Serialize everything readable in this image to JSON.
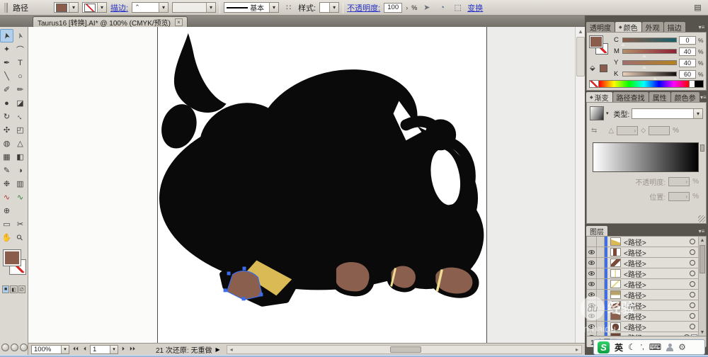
{
  "app": {
    "accent_blue": "#2936c6",
    "selection_blue": "#3b6cf0"
  },
  "control_bar": {
    "selection_type_label": "路径",
    "fill_color": "#8a5c4b",
    "stroke_link": "描边:",
    "brush_name": "基本",
    "style_label": "样式:",
    "opacity_link": "不透明度:",
    "opacity_value": "100",
    "stepper_glyph": "›",
    "percent": "%",
    "transform_link": "变换",
    "caret_glyph": "▾",
    "recolor_glyph": "∷",
    "select_similar_glyph": "➤",
    "sphere_glyph": "◔",
    "pattern_glyph": "⬚",
    "workspace_glyph": "▤"
  },
  "document_tab": {
    "title": "Taurus16 [转换].AI* @ 100% (CMYK/预览)",
    "close": "×"
  },
  "toolbox": {
    "tools": [
      {
        "name": "selection-tool",
        "glyph": "➤",
        "rotate": -105,
        "active": true
      },
      {
        "name": "direct-selection-tool",
        "glyph": "➢",
        "rotate": -105
      },
      {
        "name": "magic-wand-tool",
        "glyph": "✦"
      },
      {
        "name": "lasso-tool",
        "glyph": "⌒"
      },
      {
        "name": "pen-tool",
        "glyph": "✒"
      },
      {
        "name": "type-tool",
        "glyph": "T"
      },
      {
        "name": "line-segment-tool",
        "glyph": "╲"
      },
      {
        "name": "shape-tool",
        "glyph": "○"
      },
      {
        "name": "paintbrush-tool",
        "glyph": "✐"
      },
      {
        "name": "pencil-tool",
        "glyph": "✏"
      },
      {
        "name": "blob-brush-tool",
        "glyph": "●"
      },
      {
        "name": "eraser-tool",
        "glyph": "◪"
      },
      {
        "name": "rotate-tool",
        "glyph": "↻"
      },
      {
        "name": "scale-tool",
        "glyph": "↔",
        "rotate": 45
      },
      {
        "name": "width-tool",
        "glyph": "✣"
      },
      {
        "name": "free-transform-tool",
        "glyph": "◰"
      },
      {
        "name": "shape-builder-tool",
        "glyph": "◍"
      },
      {
        "name": "perspective-grid-tool",
        "glyph": "△"
      },
      {
        "name": "mesh-tool",
        "glyph": "▦"
      },
      {
        "name": "gradient-tool",
        "glyph": "◧"
      },
      {
        "name": "eyedropper-tool",
        "glyph": "✎"
      },
      {
        "name": "blend-tool",
        "glyph": "◑"
      },
      {
        "name": "symbol-sprayer-tool",
        "glyph": "❉"
      },
      {
        "name": "column-graph-tool",
        "glyph": "▥"
      },
      {
        "name": "warp-tool",
        "glyph": "∿",
        "color": "#b23a2e"
      },
      {
        "name": "wrinkle-tool",
        "glyph": "∿",
        "color": "#2e7d3a"
      },
      {
        "name": "perspective-selection-tool",
        "glyph": "⊕"
      },
      {
        "name": "",
        "glyph": ""
      },
      {
        "name": "artboard-tool",
        "glyph": "▭"
      },
      {
        "name": "slice-tool",
        "glyph": "✂"
      },
      {
        "name": "hand-tool",
        "glyph": "✋"
      },
      {
        "name": "zoom-tool",
        "glyph": "⚲",
        "rotate": -45
      }
    ],
    "fill_color": "#8a5c4b"
  },
  "art": {
    "black": "#0a0a0a",
    "white": "#ffffff",
    "hoof_brown": "#8a5f4d",
    "hoof_yellow": "#d9ba55",
    "stripe_yellow": "#eedc92",
    "selection": "#3b6cf0"
  },
  "panels": {
    "color": {
      "tabs": [
        "透明度",
        "颜色",
        "外观",
        "描边"
      ],
      "active": "颜色",
      "fill_color": "#8a5c4b",
      "sliders": [
        {
          "label": "C",
          "value": 0,
          "track": [
            "#8a5c4b",
            "#19606b"
          ]
        },
        {
          "label": "M",
          "value": 40,
          "track": [
            "#b3906a",
            "#8e2136"
          ]
        },
        {
          "label": "Y",
          "value": 40,
          "track": [
            "#a06f72",
            "#b5821f"
          ]
        },
        {
          "label": "K",
          "value": 60,
          "track": [
            "#e8cfba",
            "#151110"
          ]
        }
      ],
      "percent": "%",
      "spectrum": [
        "#ff0000",
        "#ffff00",
        "#00ff00",
        "#00ffff",
        "#0000ff",
        "#ff00ff",
        "#ff0000"
      ]
    },
    "gradient": {
      "tabs": [
        "渐变",
        "路径查找",
        "属性",
        "颜色参"
      ],
      "active": "渐变",
      "type_label": "类型:",
      "angle_glyph": "△",
      "reverse_glyph": "⇆",
      "aspect_glyph": "⬦",
      "stepper_glyph": "›",
      "opacity_label": "不透明度:",
      "location_label": "位置:",
      "percent": "%"
    },
    "layers": {
      "tab": "图层",
      "row_label": "<路径>",
      "status": "1 个图层",
      "rows": [
        {
          "visible": false,
          "selected": false,
          "thumb": "linear-gradient(200deg,#ffffff 45%,#d9ba55 45%)"
        },
        {
          "visible": true,
          "selected": false,
          "thumb": "linear-gradient(90deg,#ffffff 25%,#7a4a3a 25% 60%,#ffffff 60%)"
        },
        {
          "visible": true,
          "selected": false,
          "thumb": "linear-gradient(135deg,#ffffff 32%,#7a4a3a 32% 65%,#ffffff 65%)"
        },
        {
          "visible": true,
          "selected": false,
          "thumb": "linear-gradient(90deg,#ffffff 42%,#e9d98e 42% 55%,#ffffff 55%)"
        },
        {
          "visible": true,
          "selected": false,
          "thumb": "linear-gradient(135deg,#ffffff 42%,#e9d98e 42% 55%,#ffffff 55%)"
        },
        {
          "visible": true,
          "selected": false,
          "thumb": "linear-gradient(180deg,#b7a36a 0 55%,#ffffff 55%)"
        },
        {
          "visible": true,
          "selected": false,
          "thumb": "linear-gradient(160deg,#ffffff 30%,#7a4a3a 30% 75%,#ffffff 75%)"
        },
        {
          "visible": true,
          "selected": false,
          "thumb": "linear-gradient(200deg,#ffffff 25%,#8a5f4d 25%)"
        },
        {
          "visible": true,
          "selected": false,
          "thumb": "radial-gradient(circle at 50% 55%, #6e4435 55%, #ffffff 56%)"
        },
        {
          "visible": true,
          "selected": true,
          "thumb": "linear-gradient(180deg,#6e4435 60%,#ffffff 60%)"
        }
      ]
    }
  },
  "status_bar": {
    "zoom": "100%",
    "artboard_number": "1",
    "message": "21 次还原:  无重做",
    "nav_first": "⏴⏴",
    "nav_prev": "⏴",
    "nav_next": "⏵",
    "nav_last": "⏵⏵",
    "expand_glyph": "▶"
  },
  "ime_bar": {
    "logo": "S",
    "lang": "英",
    "moon": "☾",
    "punct": "’,",
    "keyboard": "⌨",
    "wrench": "⚙"
  },
  "watermark": {
    "logo": "dù",
    "text1": "经验",
    "text2": "n.baidu"
  }
}
